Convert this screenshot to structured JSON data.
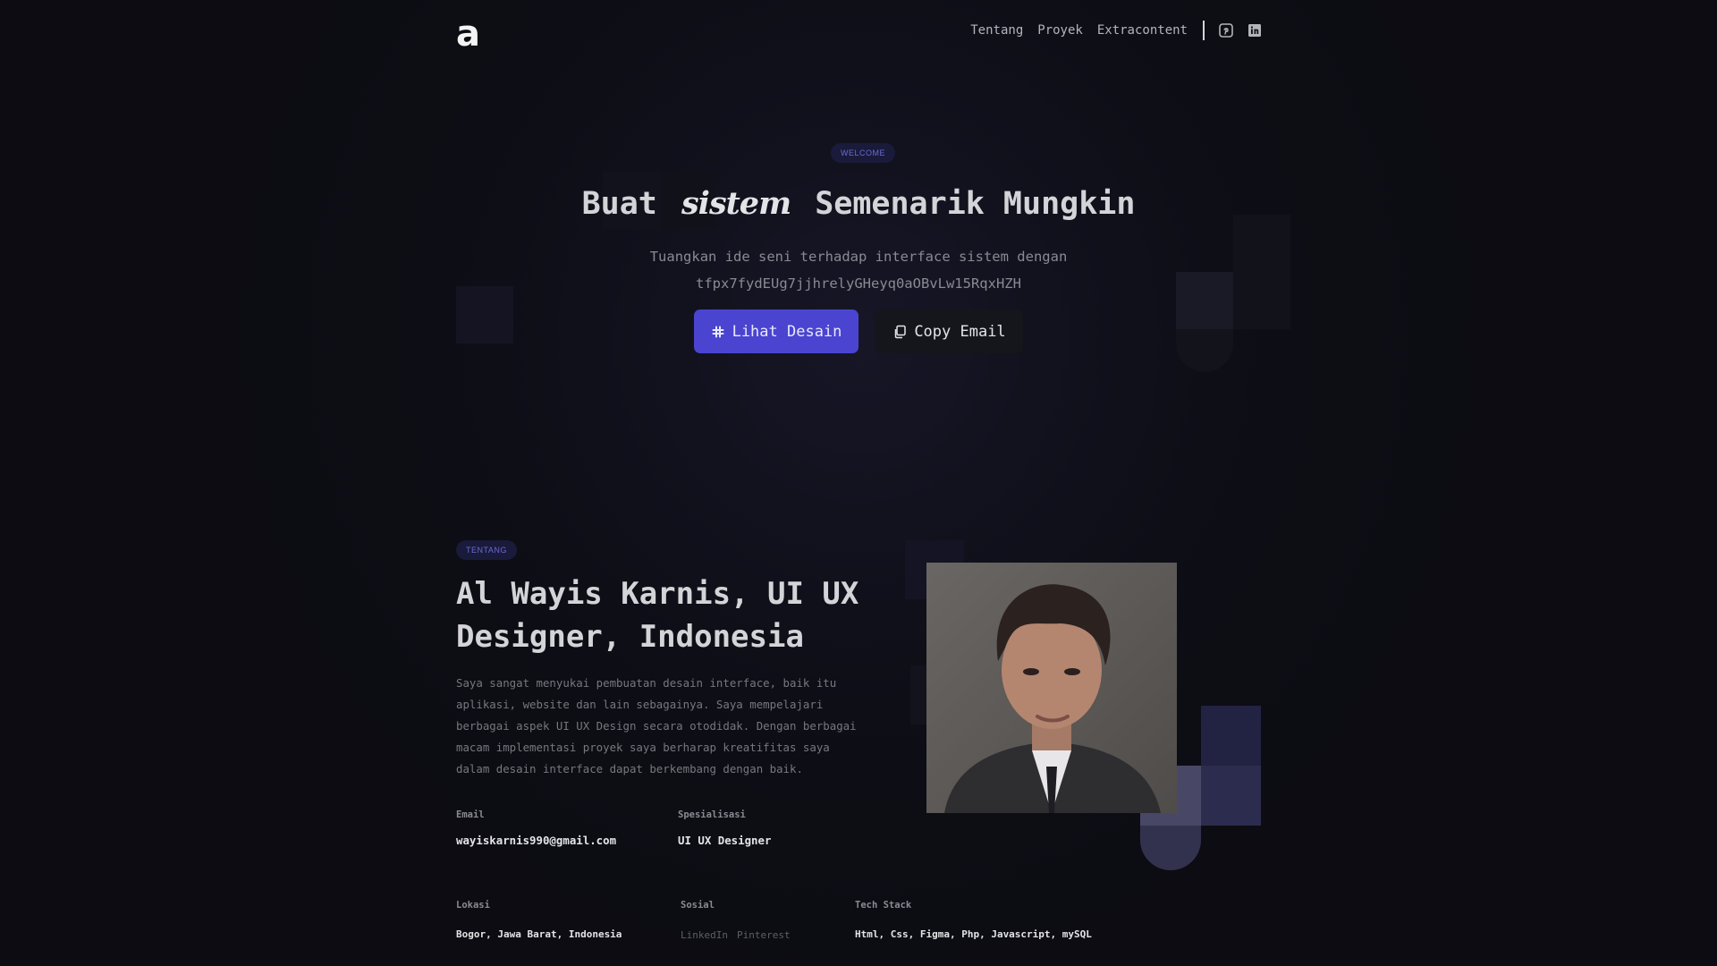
{
  "nav": {
    "logo": "a",
    "links": [
      "Tentang",
      "Proyek",
      "Extracontent"
    ],
    "icons": [
      "pinterest-icon",
      "linkedin-icon"
    ]
  },
  "hero": {
    "badge": "WELCOME",
    "title_before": "Buat",
    "title_script": "sistem",
    "title_after": "Semenarik Mungkin",
    "subtitle_line1": "Tuangkan ide seni terhadap interface sistem dengan",
    "subtitle_line2": "tfpx7fydEUg7jjhrelyGHeyq0aOBvLw15RqxHZH",
    "primary_button": "Lihat Desain",
    "secondary_button": "Copy Email"
  },
  "about": {
    "badge": "TENTANG",
    "title": "Al Wayis Karnis, UI UX Designer, Indonesia",
    "description": "Saya sangat menyukai pembuatan desain interface, baik itu aplikasi, website dan lain sebagainya. Saya mempelajari berbagai aspek UI UX Design secara otodidak. Dengan berbagai macam implementasi proyek saya berharap kreatifitas saya dalam desain interface dapat berkembang dengan baik.",
    "email_label": "Email",
    "email_value": "wayiskarnis990@gmail.com",
    "specialization_label": "Spesialisasi",
    "specialization_value": "UI UX Designer",
    "location_label": "Lokasi",
    "location_value": "Bogor, Jawa Barat, Indonesia",
    "social_label": "Sosial",
    "social_links": [
      "LinkedIn",
      "Pinterest"
    ],
    "techstack_label": "Tech Stack",
    "techstack_value": "Html, Css, Figma, Php, Javascript, mySQL"
  },
  "colors": {
    "background": "#0c0c12",
    "accent": "#4a44d0",
    "badge_bg": "#1a1a3a",
    "badge_text": "#6b6bd6"
  }
}
